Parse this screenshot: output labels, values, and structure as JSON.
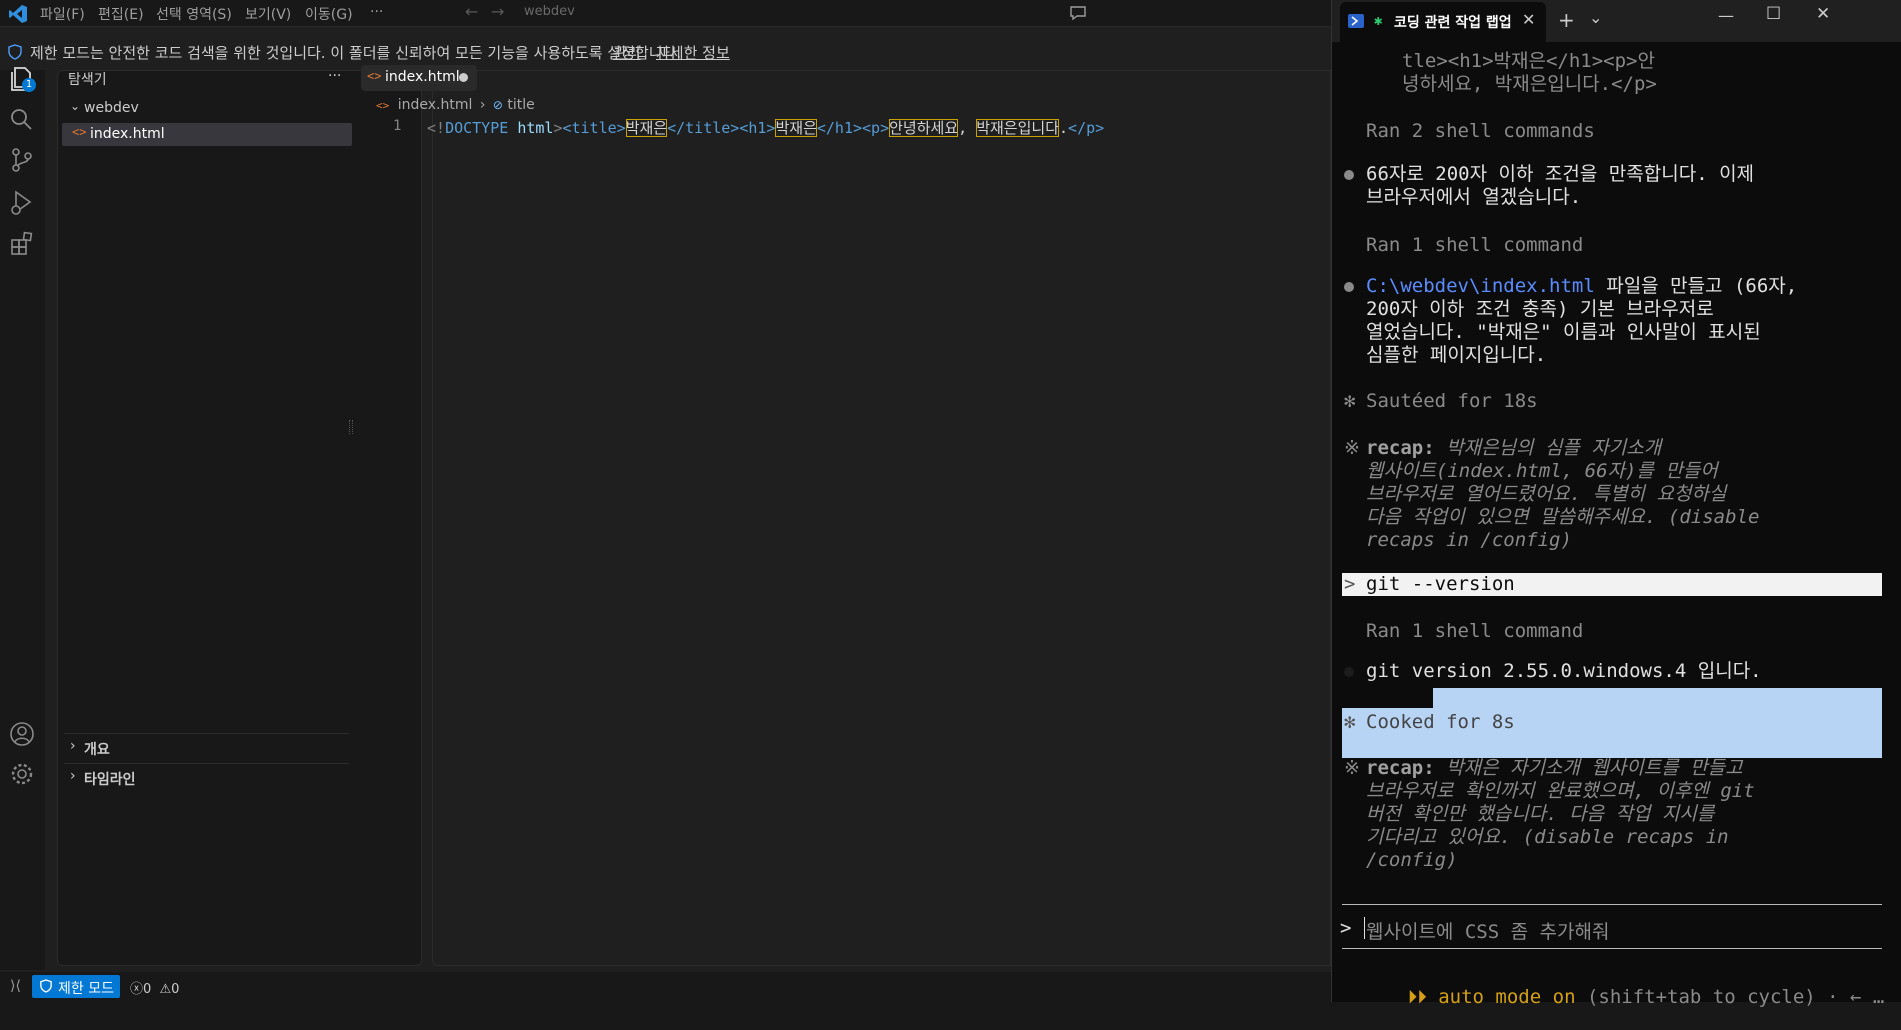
{
  "titlebar": {
    "menus": [
      "파일(F)",
      "편집(E)",
      "선택 영역(S)",
      "보기(V)",
      "이동(G)",
      "···"
    ],
    "search_text": "webdev"
  },
  "banner": {
    "message": "제한 모드는 안전한 코드 검색을 위한 것입니다. 이 폴더를 신뢰하여 모든 기능을 사용하도록 설정합니다.",
    "manage_link": "관리",
    "more_info_link": "자세한 정보"
  },
  "activitybar": {
    "explorer_badge": "1"
  },
  "sidebar": {
    "title": "탐색기",
    "more": "···",
    "folder": "webdev",
    "file": "index.html",
    "outline": "개요",
    "timeline": "타임라인"
  },
  "editor": {
    "tab_label": "index.html",
    "breadcrumb_file": "index.html",
    "breadcrumb_symbol": "title",
    "line_number": "1",
    "code": {
      "doctype_open": "<!",
      "doctype_kw": "DOCTYPE",
      "doctype_html": "html",
      "gt": ">",
      "title_open": "<title>",
      "title_text": "박재은",
      "title_close": "</title>",
      "h1_open": "<h1>",
      "h1_text": "박재은",
      "h1_close": "</h1>",
      "p_open": "<p>",
      "p_text_1": "안녕하세요",
      "comma": ", ",
      "p_text_2": "박재은입니다",
      "period": ".",
      "p_close": "</p>"
    }
  },
  "statusbar": {
    "restricted_mode": "제한 모드",
    "errors": "0",
    "warnings": "0"
  },
  "terminal": {
    "tab_title": "코딩 관련 작업 랩업",
    "lines": {
      "l1": "tle><h1>박재은</h1><p>안",
      "l2": "녕하세요, 박재은입니다.</p>",
      "ran2": "Ran 2 shell commands",
      "msg1_a": "66자로 200자 이하 조건을 만족합니다. 이제",
      "msg1_b": "브라우저에서 열겠습니다.",
      "ran1a": "Ran 1 shell command",
      "path": "C:\\webdev\\index.html",
      "msg2_a_rest": " 파일을 만들고 (66자,",
      "msg2_b": "200자 이하 조건 충족) 기본 브라우저로",
      "msg2_c": "열었습니다. \"박재은\" 이름과 인사말이 표시된",
      "msg2_d": "심플한 페이지입니다.",
      "sauteed": "Sautéed for 18s",
      "recap1_label": "recap:",
      "recap1_a": " 박재은님의 심플 자기소개",
      "recap1_b": "웹사이트(index.html, 66자)를 만들어",
      "recap1_c": "브라우저로 열어드렸어요. 특별히 요청하실",
      "recap1_d": "다음 작업이 있으면 말씀해주세요. (disable",
      "recap1_e": "recaps in /config)",
      "prompt_prev": "git --version",
      "ran1b": "Ran 1 shell command",
      "git_ver": "git version 2.55.0.windows.4 입니다.",
      "cooked": "Cooked for 8s",
      "recap2_label": "recap:",
      "recap2_a": " 박재은 자기소개 웹사이트를 만들고",
      "recap2_b": "브라우저로 확인까지 완료했으며, 이후엔 git",
      "recap2_c": "버전 확인만 했습니다. 다음 작업 지시를",
      "recap2_d": "기다리고 있어요. (disable recaps in",
      "recap2_e": "/config)"
    },
    "input_placeholder": "웹사이트에 CSS 좀 추가해줘",
    "mode_line": "auto mode on",
    "mode_hint": " (shift+tab to cycle) · ← …"
  }
}
